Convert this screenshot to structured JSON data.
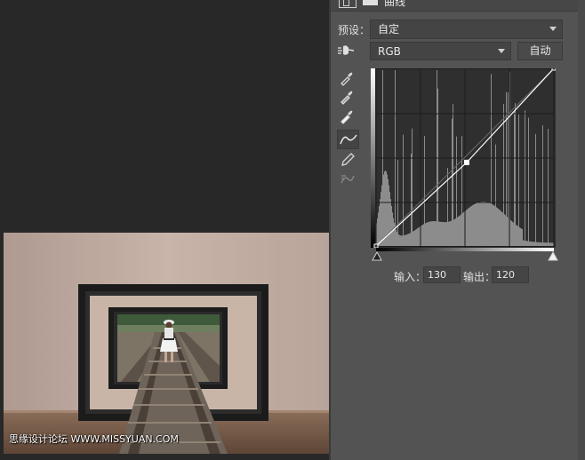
{
  "panel": {
    "title": "曲线",
    "preset_label": "预设：",
    "preset_value": "自定",
    "channel_value": "RGB",
    "auto_label": "自动",
    "input_label": "输入：",
    "input_value": "130",
    "output_label": "输出：",
    "output_value": "120"
  },
  "curve": {
    "points": [
      {
        "input": 0,
        "output": 0
      },
      {
        "input": 130,
        "output": 120
      },
      {
        "input": 255,
        "output": 255
      }
    ],
    "selected_point": 1
  },
  "tools": [
    "sample-black-eyedropper-icon",
    "sample-gray-eyedropper-icon",
    "sample-white-eyedropper-icon",
    "curve-point-tool-icon",
    "pencil-draw-icon",
    "smooth-curve-icon"
  ],
  "canvas": {
    "watermark": "思缘设计论坛  WWW.MISSYUAN.COM"
  },
  "colors": {
    "panel_bg": "#535353",
    "workspace_bg": "#282828",
    "histogram": "#8c8c8c",
    "curve_line": "#ffffff"
  }
}
